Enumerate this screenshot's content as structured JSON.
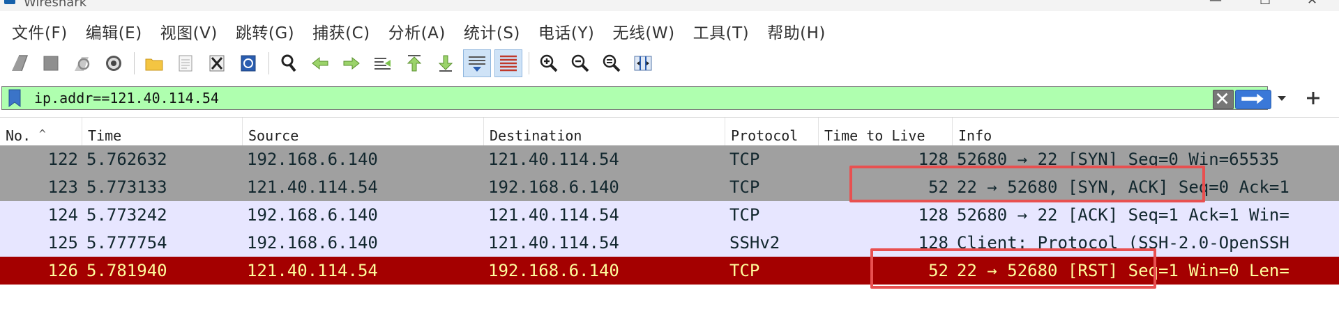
{
  "window": {
    "title": "Wireshark",
    "controls": [
      "—",
      "☐",
      "✕"
    ]
  },
  "menu": [
    "文件(F)",
    "编辑(E)",
    "视图(V)",
    "跳转(G)",
    "捕获(C)",
    "分析(A)",
    "统计(S)",
    "电话(Y)",
    "无线(W)",
    "工具(T)",
    "帮助(H)"
  ],
  "toolbar": {
    "groups": [
      [
        "start-capture-icon",
        "stop-capture-icon",
        "restart-capture-icon",
        "capture-options-icon"
      ],
      [
        "open-file-icon",
        "file-set-icon",
        "close-file-icon",
        "reload-file-icon"
      ],
      [
        "find-packet-icon",
        "go-back-icon",
        "go-forward-icon",
        "go-to-packet-icon",
        "go-first-icon",
        "go-last-icon",
        "auto-scroll-icon",
        "colorize-icon"
      ],
      [
        "zoom-in-icon",
        "zoom-out-icon",
        "normal-size-icon",
        "resize-columns-icon"
      ]
    ],
    "active": [
      "auto-scroll-icon",
      "colorize-icon"
    ]
  },
  "filter": {
    "value": "ip.addr==121.40.114.54"
  },
  "packet_list": {
    "columns": [
      "No.",
      "Time",
      "Source",
      "Destination",
      "Protocol",
      "Time to Live",
      "Info"
    ],
    "rows": [
      {
        "no": "122",
        "time": "5.762632",
        "source": "192.168.6.140",
        "destination": "121.40.114.54",
        "protocol": "TCP",
        "ttl": "128",
        "info": "52680 → 22 [SYN] Seq=0 Win=65535",
        "bg": "#a0a0a0",
        "fg": "#12272e"
      },
      {
        "no": "123",
        "time": "5.773133",
        "source": "121.40.114.54",
        "destination": "192.168.6.140",
        "protocol": "TCP",
        "ttl": "52",
        "info": "22 → 52680 [SYN, ACK] Seq=0 Ack=1",
        "bg": "#a0a0a0",
        "fg": "#12272e"
      },
      {
        "no": "124",
        "time": "5.773242",
        "source": "192.168.6.140",
        "destination": "121.40.114.54",
        "protocol": "TCP",
        "ttl": "128",
        "info": "52680 → 22 [ACK] Seq=1 Ack=1 Win=",
        "bg": "#e7e6ff",
        "fg": "#12272e"
      },
      {
        "no": "125",
        "time": "5.777754",
        "source": "192.168.6.140",
        "destination": "121.40.114.54",
        "protocol": "SSHv2",
        "ttl": "128",
        "info": "Client: Protocol (SSH-2.0-OpenSSH",
        "bg": "#e7e6ff",
        "fg": "#12272e"
      },
      {
        "no": "126",
        "time": "5.781940",
        "source": "121.40.114.54",
        "destination": "192.168.6.140",
        "protocol": "TCP",
        "ttl": "52",
        "info": "22 → 52680 [RST] Seq=1 Win=0 Len=",
        "bg": "#a40000",
        "fg": "#fffc9c"
      }
    ]
  },
  "colors": {
    "filter_valid": "#afffaf",
    "annotation": "#e85050"
  }
}
